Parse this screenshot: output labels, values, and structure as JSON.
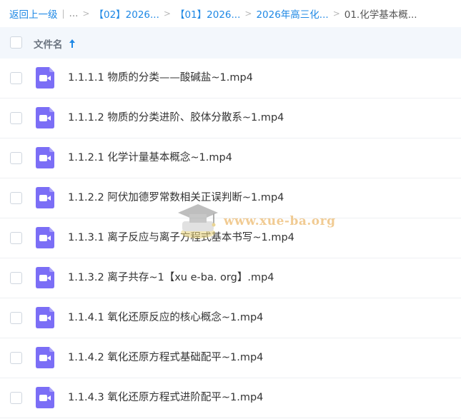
{
  "breadcrumb": {
    "back": "返回上一级",
    "divider": "|",
    "ellipsis": "...",
    "items": [
      "【02】2026...",
      "【01】2026...",
      "2026年高三化..."
    ],
    "current": "01.化学基本概...",
    "separator": ">"
  },
  "header": {
    "column_name": "文件名",
    "sort": "ascending"
  },
  "files": [
    {
      "name": "1.1.1.1 物质的分类——酸碱盐~1.mp4",
      "icon": "video-file-icon"
    },
    {
      "name": "1.1.1.2 物质的分类进阶、胶体分散系~1.mp4",
      "icon": "video-file-icon"
    },
    {
      "name": "1.1.2.1 化学计量基本概念~1.mp4",
      "icon": "video-file-icon"
    },
    {
      "name": "1.1.2.2 阿伏加德罗常数相关正误判断~1.mp4",
      "icon": "video-file-icon"
    },
    {
      "name": "1.1.3.1 离子反应与离子方程式基本书写~1.mp4",
      "icon": "video-file-icon"
    },
    {
      "name": "1.1.3.2 离子共存~1【xu e-ba. org】.mp4",
      "icon": "video-file-icon"
    },
    {
      "name": "1.1.4.1 氧化还原反应的核心概念~1.mp4",
      "icon": "video-file-icon"
    },
    {
      "name": "1.1.4.2 氧化还原方程式基础配平~1.mp4",
      "icon": "video-file-icon"
    },
    {
      "name": "1.1.4.3 氧化还原方程式进阶配平~1.mp4",
      "icon": "video-file-icon"
    }
  ],
  "watermark": {
    "text": "www.xue-ba.org"
  },
  "colors": {
    "link": "#1e88e5",
    "icon": "#7b6ef6",
    "header_bg": "#f3f7fc"
  }
}
